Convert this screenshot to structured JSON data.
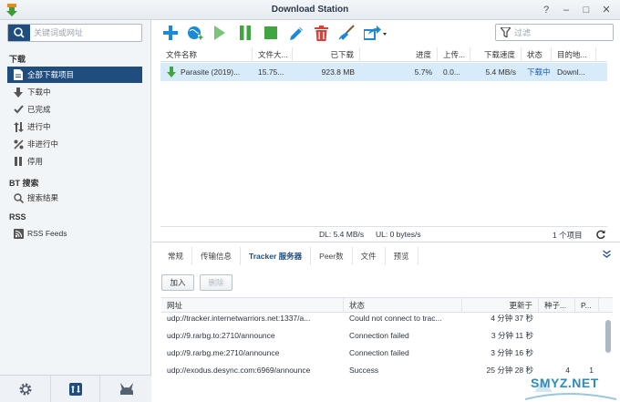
{
  "window": {
    "title": "Download Station",
    "help_glyph": "?",
    "minimize_glyph": "–",
    "maximize_glyph": "□",
    "close_glyph": "✕"
  },
  "sidebar": {
    "search_placeholder": "关键词或网址",
    "section_download": "下载",
    "items": [
      {
        "label": "全部下载项目",
        "icon": "file-icon"
      },
      {
        "label": "下载中",
        "icon": "arrow-down-icon"
      },
      {
        "label": "已完成",
        "icon": "check-icon"
      },
      {
        "label": "进行中",
        "icon": "arrows-updown-icon"
      },
      {
        "label": "非进行中",
        "icon": "percent-icon"
      },
      {
        "label": "停用",
        "icon": "pause-icon"
      }
    ],
    "section_bt": "BT 搜索",
    "bt_item": "搜索结果",
    "section_rss": "RSS",
    "rss_item": "RSS Feeds"
  },
  "toolbar": {
    "filter_placeholder": "过滤"
  },
  "downloads": {
    "columns": [
      "文件名称",
      "文件大...",
      "已下载",
      "进度",
      "上传...",
      "下载速度",
      "状态",
      "目的地..."
    ],
    "rows": [
      {
        "name": "Parasite (2019)...",
        "size": "15.75...",
        "downloaded": "923.8 MB",
        "progress": "5.7%",
        "upload": "0.0...",
        "speed": "5.4 MB/s",
        "status": "下载中",
        "destination": "Downl..."
      }
    ],
    "status_dl": "DL:  5.4 MB/s",
    "status_ul": "UL:  0 bytes/s",
    "item_count": "1 个项目"
  },
  "detail": {
    "tabs": [
      "常规",
      "传输信息",
      "Tracker 服务器",
      "Peer数",
      "文件",
      "预览"
    ],
    "active_tab": "Tracker 服务器",
    "add_label": "加入",
    "delete_label": "删除",
    "columns": [
      "网址",
      "状态",
      "更新于",
      "种子...",
      "P..."
    ],
    "trackers": [
      {
        "url": "udp://tracker.internetwarriors.net:1337/a...",
        "status": "Could not connect to trac...",
        "updated": "4 分钟 37 秒",
        "seeds": "",
        "peers": ""
      },
      {
        "url": "udp://9.rarbg.to:2710/announce",
        "status": "Connection failed",
        "updated": "3 分钟 11 秒",
        "seeds": "",
        "peers": ""
      },
      {
        "url": "udp://9.rarbg.me:2710/announce",
        "status": "Connection failed",
        "updated": "3 分钟 16 秒",
        "seeds": "",
        "peers": ""
      },
      {
        "url": "udp://exodus.desync.com:6969/announce",
        "status": "Success",
        "updated": "25 分钟 28 秒",
        "seeds": "4",
        "peers": "1"
      }
    ]
  },
  "watermark": {
    "text": "SMYZ.NET"
  },
  "colors": {
    "accent": "#1f4e7e",
    "selected_row": "#d8ebfb",
    "add_blue": "#1a8ad4",
    "play_green": "#3fa63f",
    "delete_red": "#d9423a"
  }
}
